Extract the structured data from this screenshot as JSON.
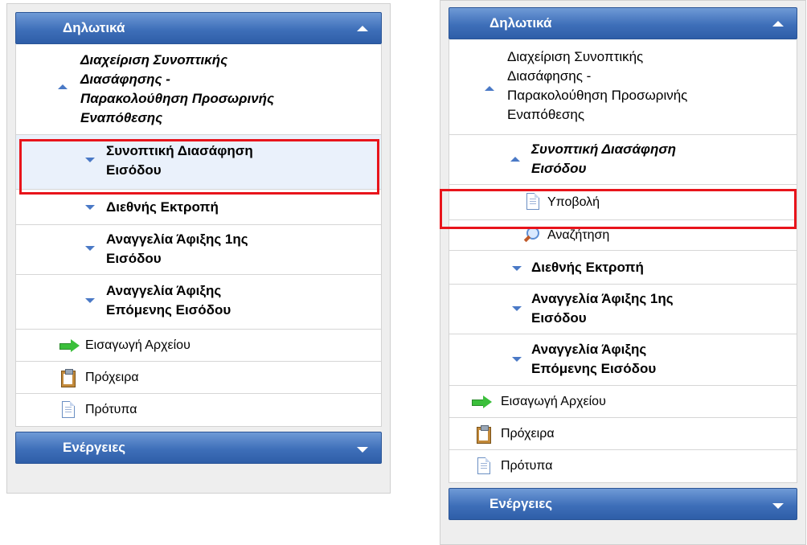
{
  "left_panel": {
    "header_title": "Δηλωτικά",
    "section_title_lines": [
      "Διαχείριση Συνοπτικής",
      "Διασάφησης -",
      "Παρακολούθηση Προσωρινής",
      "Εναπόθεσης"
    ],
    "item_entry_lines": [
      "Συνοπτική Διασάφηση",
      "Εισόδου"
    ],
    "item_diversion": "Διεθνής Εκτροπή",
    "item_first_arrival_lines": [
      "Αναγγελία Άφιξης 1ης",
      "Εισόδου"
    ],
    "item_next_arrival_lines": [
      "Αναγγελία Άφιξης",
      "Επόμενης Εισόδου"
    ],
    "import_file": "Εισαγωγή Αρχείου",
    "drafts": "Πρόχειρα",
    "templates": "Πρότυπα",
    "actions_title": "Ενέργειες"
  },
  "right_panel": {
    "header_title": "Δηλωτικά",
    "section_title_lines": [
      "Διαχείριση Συνοπτικής",
      "Διασάφησης -",
      "Παρακολούθηση Προσωρινής",
      "Εναπόθεσης"
    ],
    "item_entry_lines": [
      "Συνοπτική Διασάφηση",
      "Εισόδου"
    ],
    "submit": "Υποβολή",
    "search": "Αναζήτηση",
    "item_diversion": "Διεθνής Εκτροπή",
    "item_first_arrival_lines": [
      "Αναγγελία Άφιξης 1ης",
      "Εισόδου"
    ],
    "item_next_arrival_lines": [
      "Αναγγελία Άφιξης",
      "Επόμενης Εισόδου"
    ],
    "import_file": "Εισαγωγή Αρχείου",
    "drafts": "Πρόχειρα",
    "templates": "Πρότυπα",
    "actions_title": "Ενέργειες"
  },
  "colors": {
    "header_blue": "#3e6fb9",
    "highlight_red": "#e8141b",
    "arrow_blue": "#4a79c6"
  },
  "icons": [
    "chevron-up-icon",
    "chevron-down-icon",
    "green-arrow-icon",
    "clipboard-icon",
    "document-icon",
    "magnifier-icon"
  ]
}
